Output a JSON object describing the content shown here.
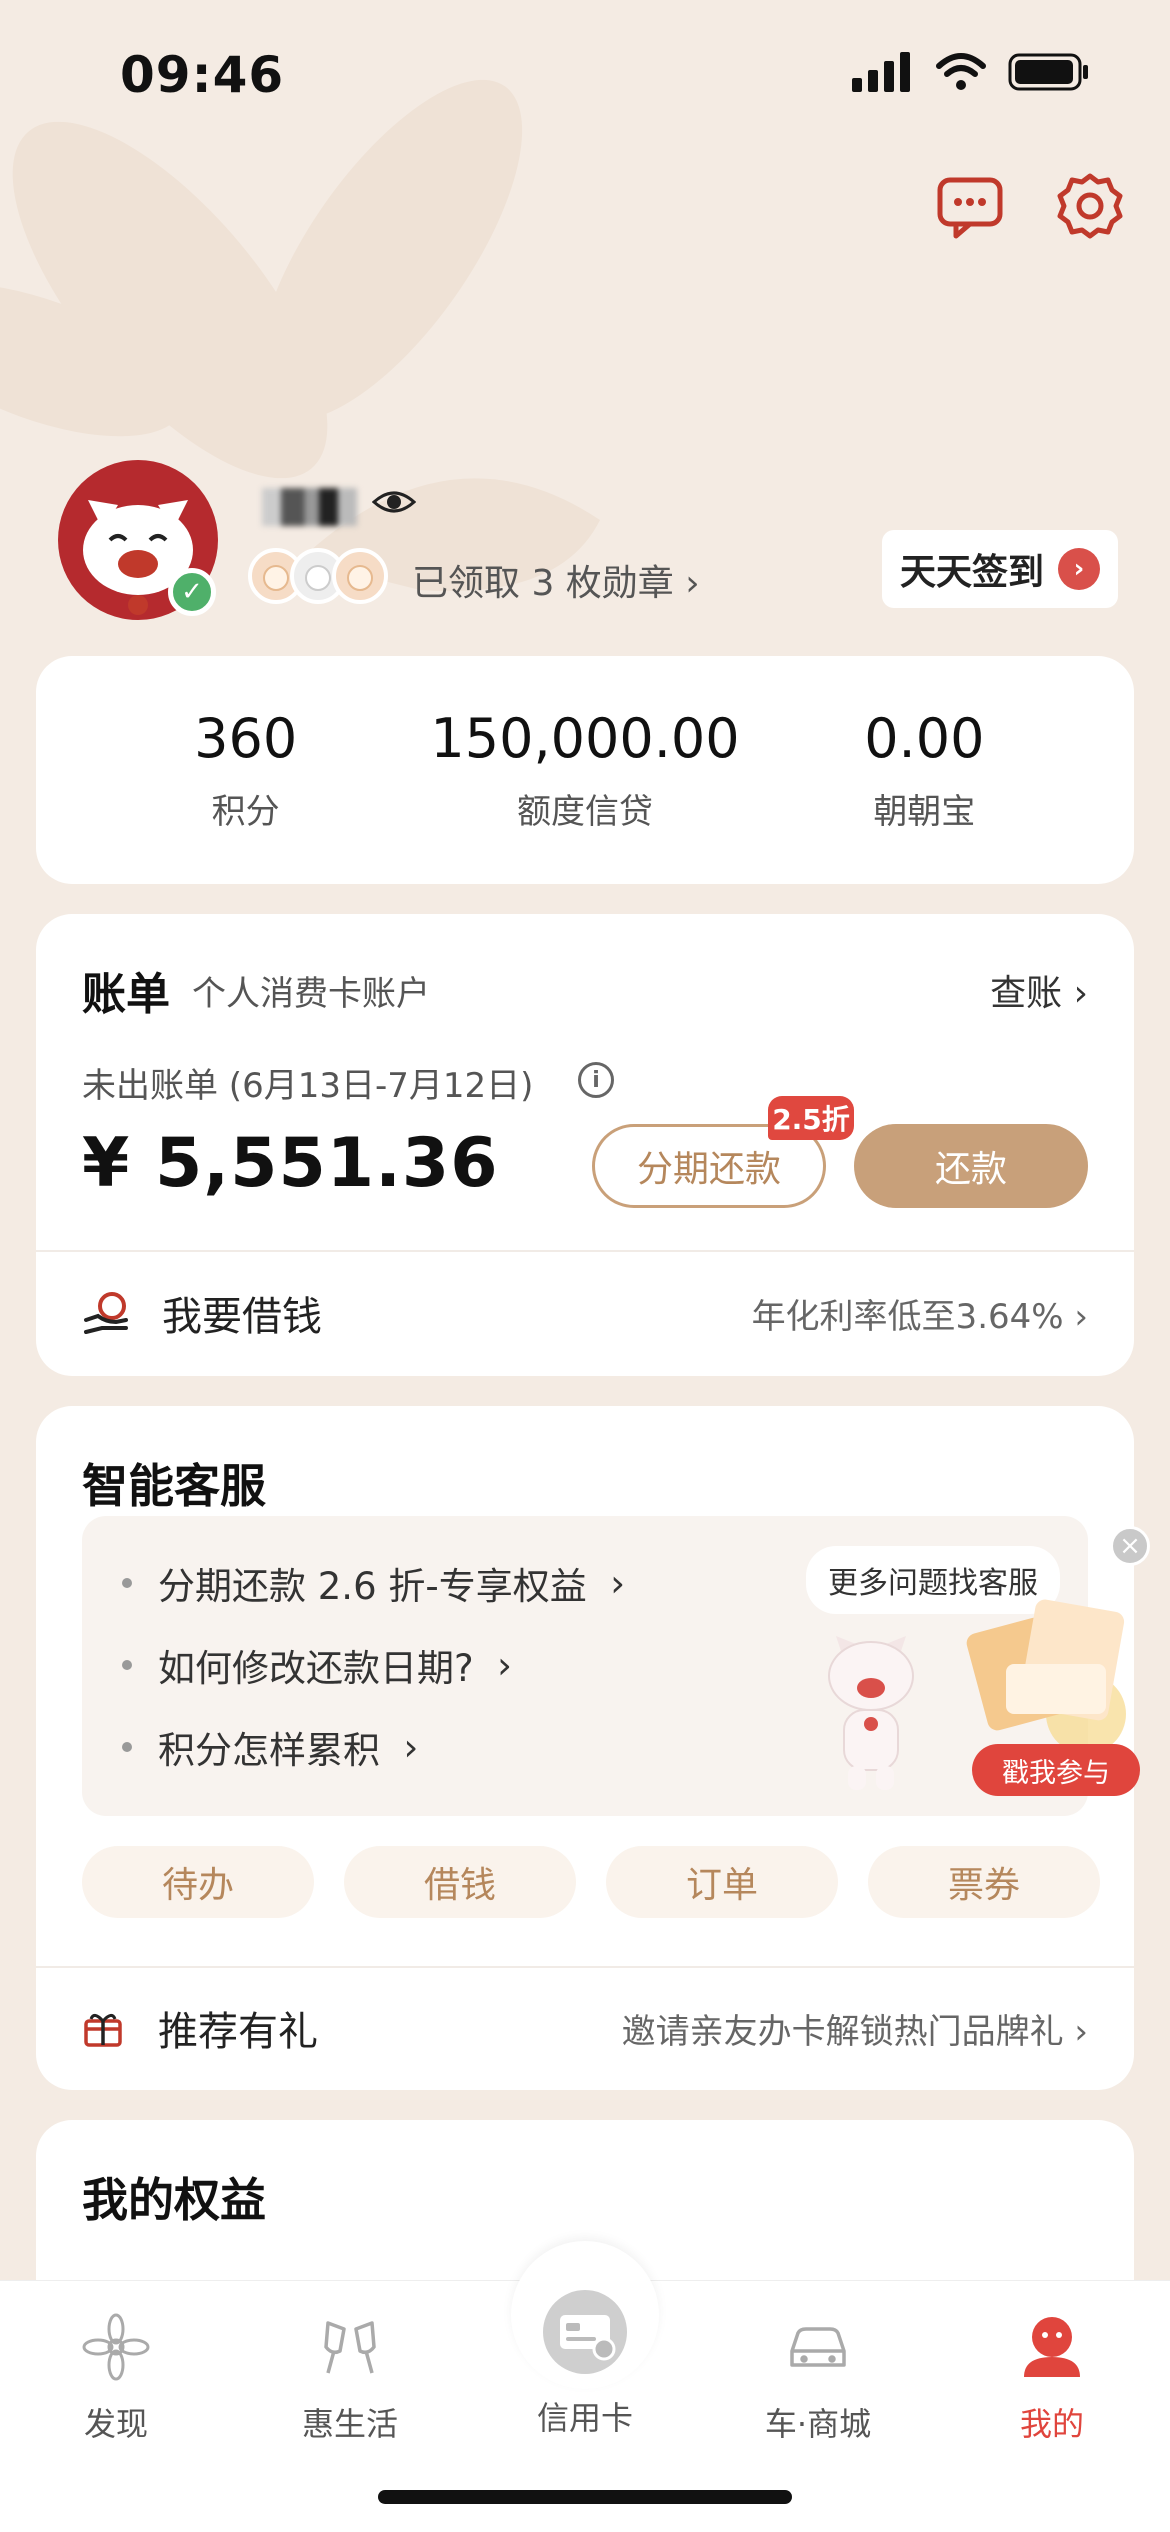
{
  "status_bar": {
    "time": "09:46"
  },
  "profile": {
    "medal_text": "已领取 3 枚勋章",
    "checkin_label": "天天签到"
  },
  "stats": [
    {
      "value": "360",
      "label": "积分"
    },
    {
      "value": "150,000.00",
      "label": "额度信贷"
    },
    {
      "value": "0.00",
      "label": "朝朝宝"
    }
  ],
  "bill": {
    "title": "账单",
    "subtitle": "个人消费卡账户",
    "check_label": "查账",
    "period": "未出账单 (6月13日-7月12日)",
    "amount": "¥ 5,551.36",
    "discount_tag": "2.5折",
    "installment_label": "分期还款",
    "repay_label": "还款",
    "borrow_label": "我要借钱",
    "borrow_rate": "年化利率低至3.64%"
  },
  "service": {
    "title": "智能客服",
    "faq": [
      {
        "label": "分期还款 2.6 折-专享权益"
      },
      {
        "label": "如何修改还款日期?"
      },
      {
        "label": "积分怎样累积"
      }
    ],
    "bubble": "更多问题找客服",
    "promo_button": "戳我参与",
    "chips": [
      "待办",
      "借钱",
      "订单",
      "票券"
    ],
    "refer_label": "推荐有礼",
    "refer_desc": "邀请亲友办卡解锁热门品牌礼"
  },
  "benefits": {
    "title": "我的权益"
  },
  "tabbar": [
    {
      "label": "发现",
      "icon": "flower-icon"
    },
    {
      "label": "惠生活",
      "icon": "cheers-icon"
    },
    {
      "label": "信用卡",
      "icon": "credit-card-icon"
    },
    {
      "label": "车·商城",
      "icon": "car-icon"
    },
    {
      "label": "我的",
      "icon": "profile-icon",
      "active": true
    }
  ],
  "colors": {
    "accent": "#c8a07a",
    "active_tab": "#e0453d",
    "background": "#f4ebe3"
  }
}
